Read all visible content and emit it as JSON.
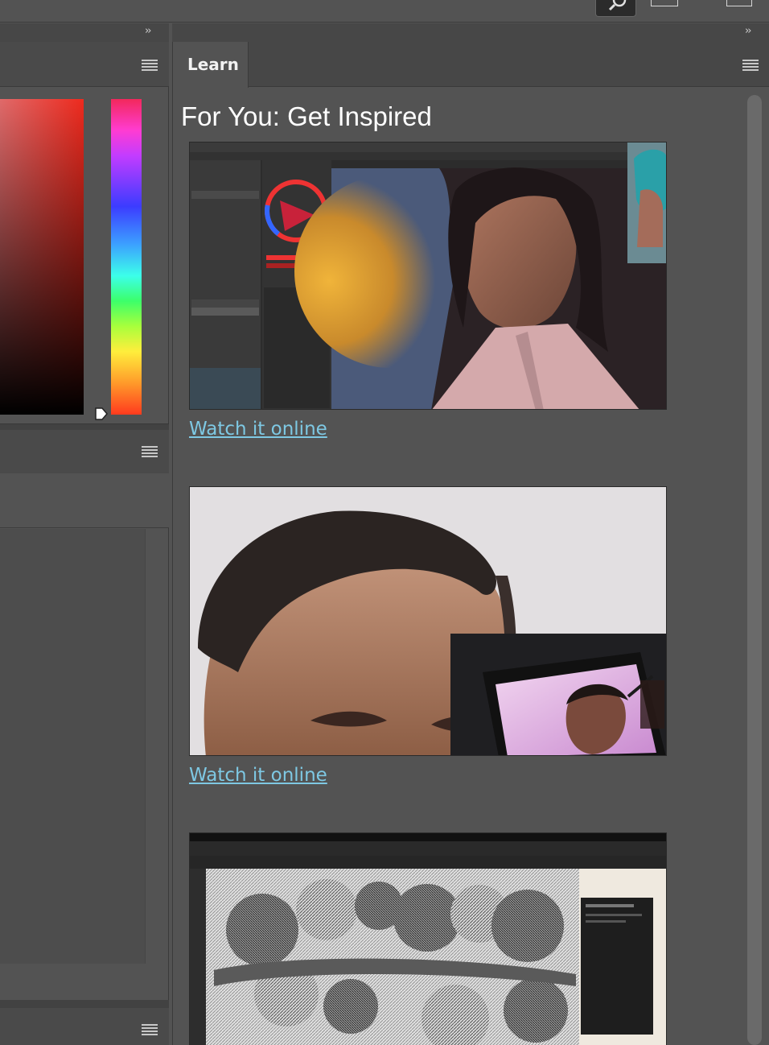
{
  "toolbar": {
    "search_icon": "search-icon",
    "collapse_glyph": "››"
  },
  "left_panel": {
    "menu_icon": "panel-menu-icon",
    "color_picker": {
      "field_color_top_right": "#ee2a1e",
      "hue_selected": "#ff3a1e"
    }
  },
  "learn_panel": {
    "tab_label": "Learn",
    "heading": "For You: Get Inspired",
    "cards": [
      {
        "link_text": "Watch it online"
      },
      {
        "link_text": "Watch it online"
      },
      {
        "link_text": ""
      }
    ]
  },
  "colors": {
    "panel_bg": "#535353",
    "tab_bar_bg": "#474747",
    "link": "#7ec8e3",
    "heading": "#ffffff"
  }
}
